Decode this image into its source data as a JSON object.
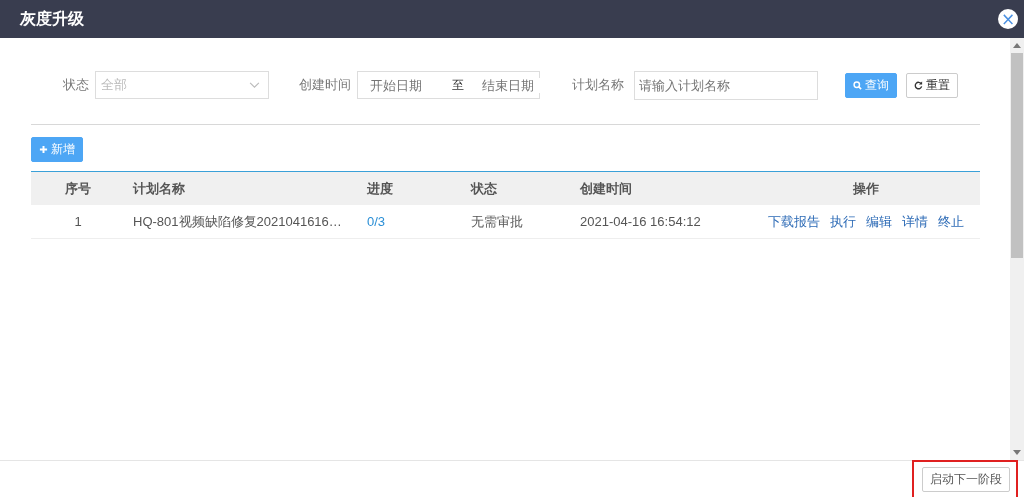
{
  "dialog": {
    "title": "灰度升级",
    "close": "×"
  },
  "filters": {
    "status": {
      "label": "状态",
      "value": "全部"
    },
    "created": {
      "label": "创建时间",
      "start_placeholder": "开始日期",
      "separator": "至",
      "end_placeholder": "结束日期"
    },
    "plan_name": {
      "label": "计划名称",
      "placeholder": "请输入计划名称"
    },
    "search_button": "查询",
    "reset_button": "重置"
  },
  "add_button": "新增",
  "table": {
    "columns": [
      "序号",
      "计划名称",
      "进度",
      "状态",
      "创建时间",
      "操作"
    ],
    "rows": [
      {
        "index": "1",
        "name": "HQ-801视频缺陷修复2021041616…",
        "progress": "0/3",
        "status": "无需审批",
        "created": "2021-04-16 16:54:12",
        "actions": [
          "下载报告",
          "执行",
          "编辑",
          "详情",
          "终止"
        ]
      }
    ]
  },
  "footer": {
    "button": "启动下一阶段",
    "highlighted": true
  }
}
